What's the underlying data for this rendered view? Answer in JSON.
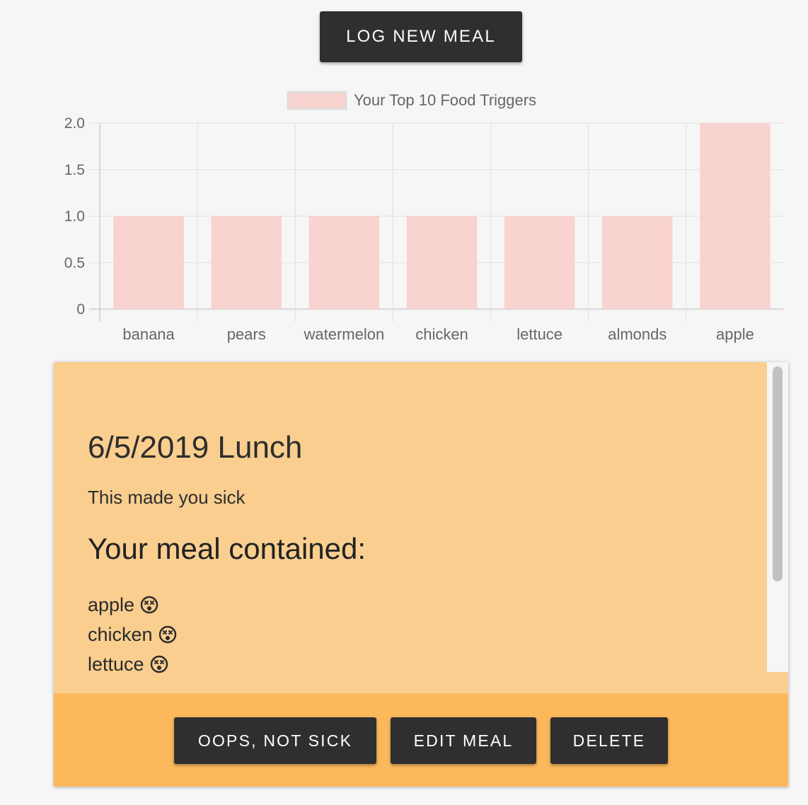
{
  "actions": {
    "log_meal_label": "LOG NEW MEAL"
  },
  "chart_data": {
    "type": "bar",
    "legend": {
      "label": "Your Top 10 Food Triggers",
      "position": "top",
      "fill": "#f9d3cf",
      "border": "#e0b0ab"
    },
    "categories": [
      "banana",
      "pears",
      "watermelon",
      "chicken",
      "lettuce",
      "almonds",
      "apple"
    ],
    "series": [
      {
        "name": "Your Top 10 Food Triggers",
        "values": [
          1,
          1,
          1,
          1,
          1,
          1,
          2
        ]
      }
    ],
    "ylim": [
      0,
      2
    ],
    "yticks": [
      "0",
      "0.5",
      "1.0",
      "1.5",
      "2.0"
    ],
    "grid": true,
    "bar_color": "#f9d3cf"
  },
  "meal": {
    "title": "6/5/2019 Lunch",
    "status": "This made you sick",
    "heading": "Your meal contained:",
    "foods": [
      {
        "name": "apple",
        "icon": "dizzy-face-icon"
      },
      {
        "name": "chicken",
        "icon": "dizzy-face-icon"
      },
      {
        "name": "lettuce",
        "icon": "dizzy-face-icon"
      }
    ],
    "card_color": "#f9ce8f",
    "actions_color": "#fcb95b"
  },
  "card_actions": {
    "oops_label": "OOPS, NOT SICK",
    "edit_label": "EDIT MEAL",
    "delete_label": "DELETE"
  }
}
